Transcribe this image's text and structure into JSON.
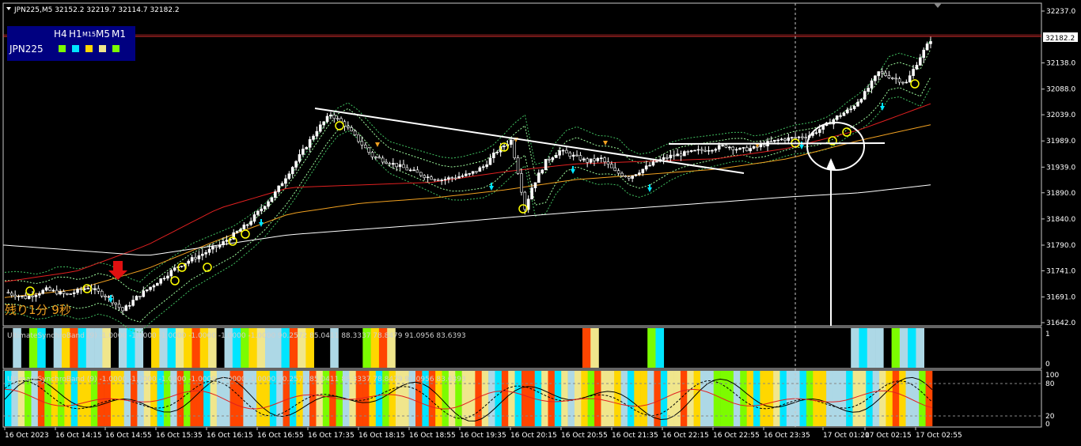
{
  "header": {
    "symbol_info": "JPN225,M5  32152.2 32219.7 32114.7 32182.2"
  },
  "timeframe_panel": {
    "timeframes": [
      "H4",
      "H1",
      "M15",
      "M5",
      "M1"
    ],
    "symbol": "JPN225",
    "status_colors": [
      "#7cfc00",
      "#00e5ff",
      "#ffd700",
      "#f0e68c",
      "#7cfc00"
    ]
  },
  "timer_text": "残り1分 9秒",
  "indicator1": {
    "label": "UltimateSynchroBand (9) -1.0000 -1.0000 -1.0000 -1.0000 -1.0000 -1.0000 90.2572 85.0411 88.3337 78.8479 91.0956 83.6393",
    "levels": [
      "1",
      "0"
    ]
  },
  "indicator2": {
    "label": "UltimateSynchroBand (9) -1.0000 -1.0000 -1.0000 -1.0000 -1.0000 -1.0000 90.2572 85.0411 88.3337 78.8479 91.0956 83.6393",
    "levels": [
      "100",
      "80",
      "20",
      "0"
    ]
  },
  "colors": {
    "bull_candle": "#ffffff",
    "bear_candle": "#ffffff",
    "candle_body_bear": "#000000",
    "bid_line": "#e03030",
    "price_tag_bg": "#ffffff",
    "trend_line": "#ffffff",
    "ma_red": "#e02020",
    "ma_orange": "#f0a020",
    "band_green": "#40c060",
    "ma_white": "#ffffff",
    "histogram_palette": [
      "#000000",
      "#add8e6",
      "#00e5ff",
      "#7cfc00",
      "#ffd700",
      "#f0e68c",
      "#ff4500"
    ]
  },
  "chart_data": {
    "type": "line",
    "title": "JPN225,M5",
    "current_price": "32182.2",
    "ohlc": {
      "open": 32152.2,
      "high": 32219.7,
      "low": 32114.7,
      "close": 32182.2
    },
    "ylim": [
      31630,
      32250
    ],
    "y_ticks": [
      "32237.0",
      "32182.2",
      "32138.0",
      "32088.0",
      "32039.0",
      "31989.0",
      "31939.0",
      "31890.0",
      "31840.0",
      "31790.0",
      "31741.0",
      "31691.0",
      "31642.0"
    ],
    "x_ticks": [
      "16 Oct 2023",
      "16 Oct 14:15",
      "16 Oct 14:55",
      "16 Oct 15:35",
      "16 Oct 16:15",
      "16 Oct 16:55",
      "16 Oct 17:35",
      "16 Oct 18:15",
      "16 Oct 18:55",
      "16 Oct 19:35",
      "16 Oct 20:15",
      "16 Oct 20:55",
      "16 Oct 21:35",
      "16 Oct 22:15",
      "16 Oct 22:55",
      "16 Oct 23:35",
      "17 Oct 01:20",
      "17 Oct 02:15",
      "17 Oct 02:55"
    ],
    "price_path": [
      [
        0,
        31700
      ],
      [
        6,
        31690
      ],
      [
        12,
        31705
      ],
      [
        18,
        31695
      ],
      [
        24,
        31710
      ],
      [
        30,
        31690
      ],
      [
        34,
        31665
      ],
      [
        38,
        31690
      ],
      [
        44,
        31720
      ],
      [
        50,
        31750
      ],
      [
        56,
        31770
      ],
      [
        62,
        31790
      ],
      [
        66,
        31810
      ],
      [
        70,
        31830
      ],
      [
        74,
        31860
      ],
      [
        78,
        31890
      ],
      [
        82,
        31930
      ],
      [
        86,
        31970
      ],
      [
        90,
        32010
      ],
      [
        94,
        32040
      ],
      [
        98,
        32020
      ],
      [
        102,
        31990
      ],
      [
        106,
        31960
      ],
      [
        110,
        31950
      ],
      [
        114,
        31940
      ],
      [
        118,
        31930
      ],
      [
        122,
        31920
      ],
      [
        126,
        31915
      ],
      [
        130,
        31920
      ],
      [
        134,
        31925
      ],
      [
        138,
        31940
      ],
      [
        142,
        31970
      ],
      [
        146,
        31990
      ],
      [
        148,
        31930
      ],
      [
        150,
        31860
      ],
      [
        152,
        31900
      ],
      [
        156,
        31950
      ],
      [
        160,
        31970
      ],
      [
        164,
        31960
      ],
      [
        168,
        31950
      ],
      [
        172,
        31955
      ],
      [
        176,
        31930
      ],
      [
        180,
        31920
      ],
      [
        184,
        31935
      ],
      [
        188,
        31950
      ],
      [
        192,
        31960
      ],
      [
        196,
        31965
      ],
      [
        200,
        31970
      ],
      [
        204,
        31975
      ],
      [
        208,
        31980
      ],
      [
        212,
        31972
      ],
      [
        216,
        31975
      ],
      [
        220,
        31985
      ],
      [
        224,
        31992
      ],
      [
        228,
        31995
      ],
      [
        232,
        32000
      ],
      [
        236,
        32015
      ],
      [
        240,
        32035
      ],
      [
        244,
        32050
      ],
      [
        248,
        32080
      ],
      [
        252,
        32120
      ],
      [
        256,
        32110
      ],
      [
        260,
        32100
      ],
      [
        264,
        32150
      ],
      [
        267,
        32182.2
      ]
    ],
    "series": [
      {
        "values": [
          31720,
          31740,
          31790,
          31860,
          31900,
          31905,
          31910,
          31930,
          31945,
          31950,
          31955,
          31975,
          32010,
          32060
        ]
      },
      {
        "values": [
          31690,
          31705,
          31745,
          31800,
          31850,
          31870,
          31880,
          31895,
          31915,
          31925,
          31935,
          31955,
          31990,
          32020
        ]
      },
      {
        "values": [
          31790,
          31780,
          31770,
          31790,
          31810,
          31820,
          31830,
          31842,
          31853,
          31862,
          31872,
          31882,
          31890,
          31905
        ]
      }
    ]
  }
}
